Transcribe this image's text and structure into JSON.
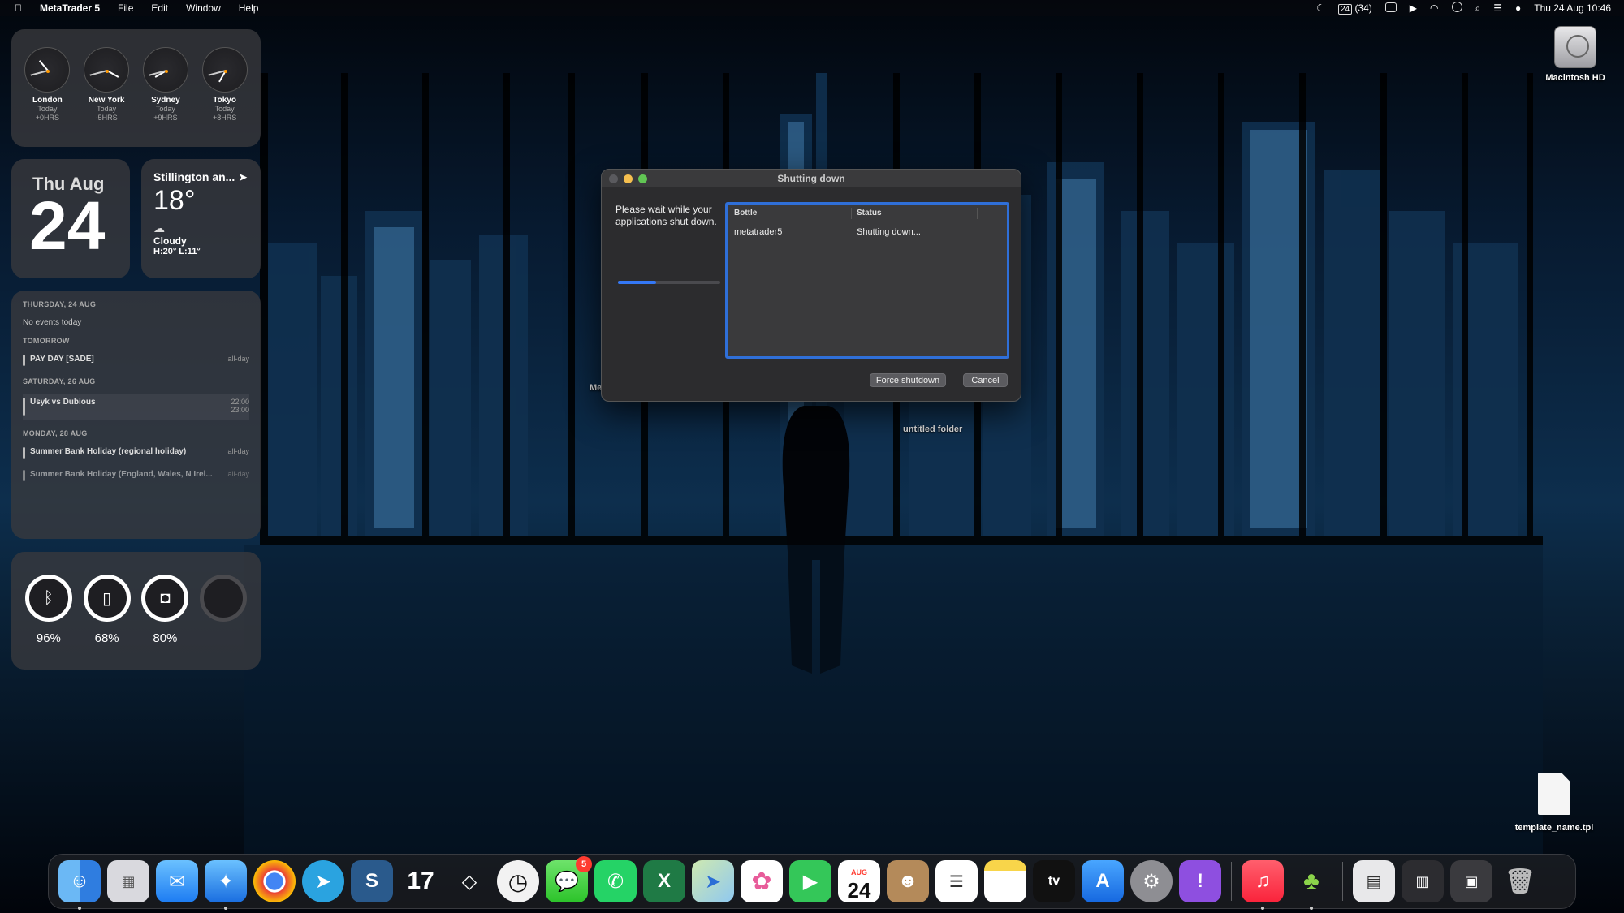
{
  "menubar": {
    "app_name": "MetaTrader 5",
    "menus": [
      "File",
      "Edit",
      "Window",
      "Help"
    ],
    "status_count": "(34)",
    "calendar_day": "24",
    "datetime": "Thu 24 Aug  10:46"
  },
  "clocks": [
    {
      "city": "London",
      "day": "Today",
      "offset": "+0HRS"
    },
    {
      "city": "New York",
      "day": "Today",
      "offset": "-5HRS"
    },
    {
      "city": "Sydney",
      "day": "Today",
      "offset": "+9HRS"
    },
    {
      "city": "Tokyo",
      "day": "Today",
      "offset": "+8HRS"
    }
  ],
  "date_widget": {
    "dayname": "Thu",
    "month": "Aug",
    "daynum": "24"
  },
  "weather": {
    "location": "Stillington an...",
    "temp": "18°",
    "condition": "Cloudy",
    "hilo": "H:20° L:11°"
  },
  "calendar": {
    "sections": [
      {
        "header": "THURSDAY, 24 AUG",
        "none": "No events today"
      },
      {
        "header": "TOMORROW",
        "events": [
          {
            "title": "PAY DAY [SADE]",
            "time": "all-day"
          }
        ]
      },
      {
        "header": "SATURDAY, 26 AUG",
        "events": [
          {
            "title": "Usyk vs Dubious",
            "start": "22:00",
            "end": "23:00"
          }
        ]
      },
      {
        "header": "MONDAY, 28 AUG",
        "events": [
          {
            "title": "Summer Bank Holiday (regional holiday)",
            "time": "all-day"
          },
          {
            "title": "Summer Bank Holiday (England, Wales, N Irel...",
            "time": "all-day"
          }
        ]
      }
    ]
  },
  "batteries": [
    {
      "icon": "bluetooth-icon",
      "glyph": "ᛒ",
      "percent": "96%"
    },
    {
      "icon": "mouse-icon",
      "glyph": "▯",
      "percent": "68%"
    },
    {
      "icon": "speaker-icon",
      "glyph": "◘",
      "percent": "80%"
    }
  ],
  "desktop": {
    "hd_label": "Macintosh HD",
    "file_label": "template_name.tpl",
    "ghost_label_1": "untitled folder",
    "ghost_label_2": "Me"
  },
  "dialog": {
    "title": "Shutting down",
    "message": "Please wait while your applications shut down.",
    "progress": 0.37,
    "columns": [
      "Bottle",
      "Status"
    ],
    "rows": [
      {
        "bottle": "metatrader5",
        "status": "Shutting down..."
      }
    ],
    "force_label": "Force shutdown",
    "cancel_label": "Cancel"
  },
  "dock": {
    "messages_badge": "5",
    "calendar_month": "AUG",
    "calendar_day": "24",
    "apps": [
      "Finder",
      "Launchpad",
      "Mail",
      "Safari",
      "Chrome",
      "Telegram",
      "Scrivener",
      "TradingView",
      "Linear",
      "Clock",
      "Messages",
      "WhatsApp",
      "Excel",
      "Maps",
      "Photos",
      "FaceTime",
      "Calendar",
      "Contacts",
      "Reminders",
      "Notes",
      "Apple TV",
      "App Store",
      "System Settings",
      "Feedback",
      "Music",
      "CrossOver",
      "Preview",
      "Downloads",
      "Screenshots",
      "Trash"
    ]
  },
  "colors": {
    "accent": "#3478f6",
    "badge": "#ff3b30"
  }
}
